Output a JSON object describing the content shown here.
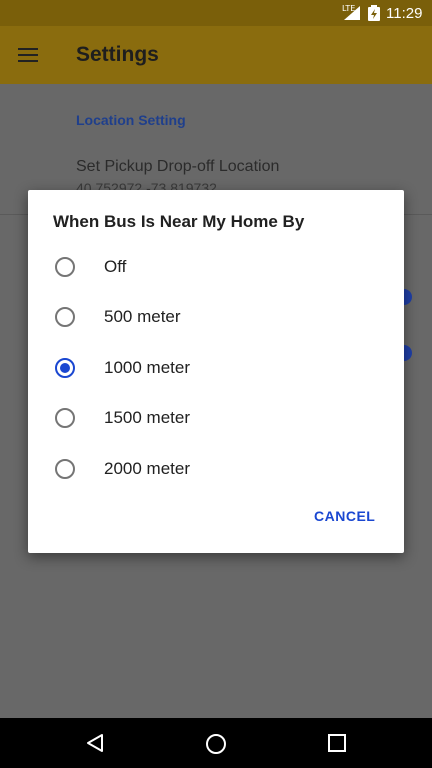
{
  "status_bar": {
    "network": "LTE",
    "time": "11:29"
  },
  "app_bar": {
    "title": "Settings",
    "menu_icon": "hamburger-menu-icon"
  },
  "background": {
    "section_label": "Location Setting",
    "item_title": "Set Pickup Drop-off Location",
    "item_subtitle": "40.752972,-73.819732"
  },
  "dialog": {
    "title": "When Bus Is Near My Home By",
    "options": [
      {
        "label": "Off",
        "selected": false
      },
      {
        "label": "500 meter",
        "selected": false
      },
      {
        "label": "1000 meter",
        "selected": true
      },
      {
        "label": "1500 meter",
        "selected": false
      },
      {
        "label": "2000 meter",
        "selected": false
      }
    ],
    "cancel_label": "CANCEL"
  },
  "colors": {
    "accent": "#1a47d1",
    "app_bar": "#8a6c0e",
    "status_bar": "#7a5f0a"
  }
}
